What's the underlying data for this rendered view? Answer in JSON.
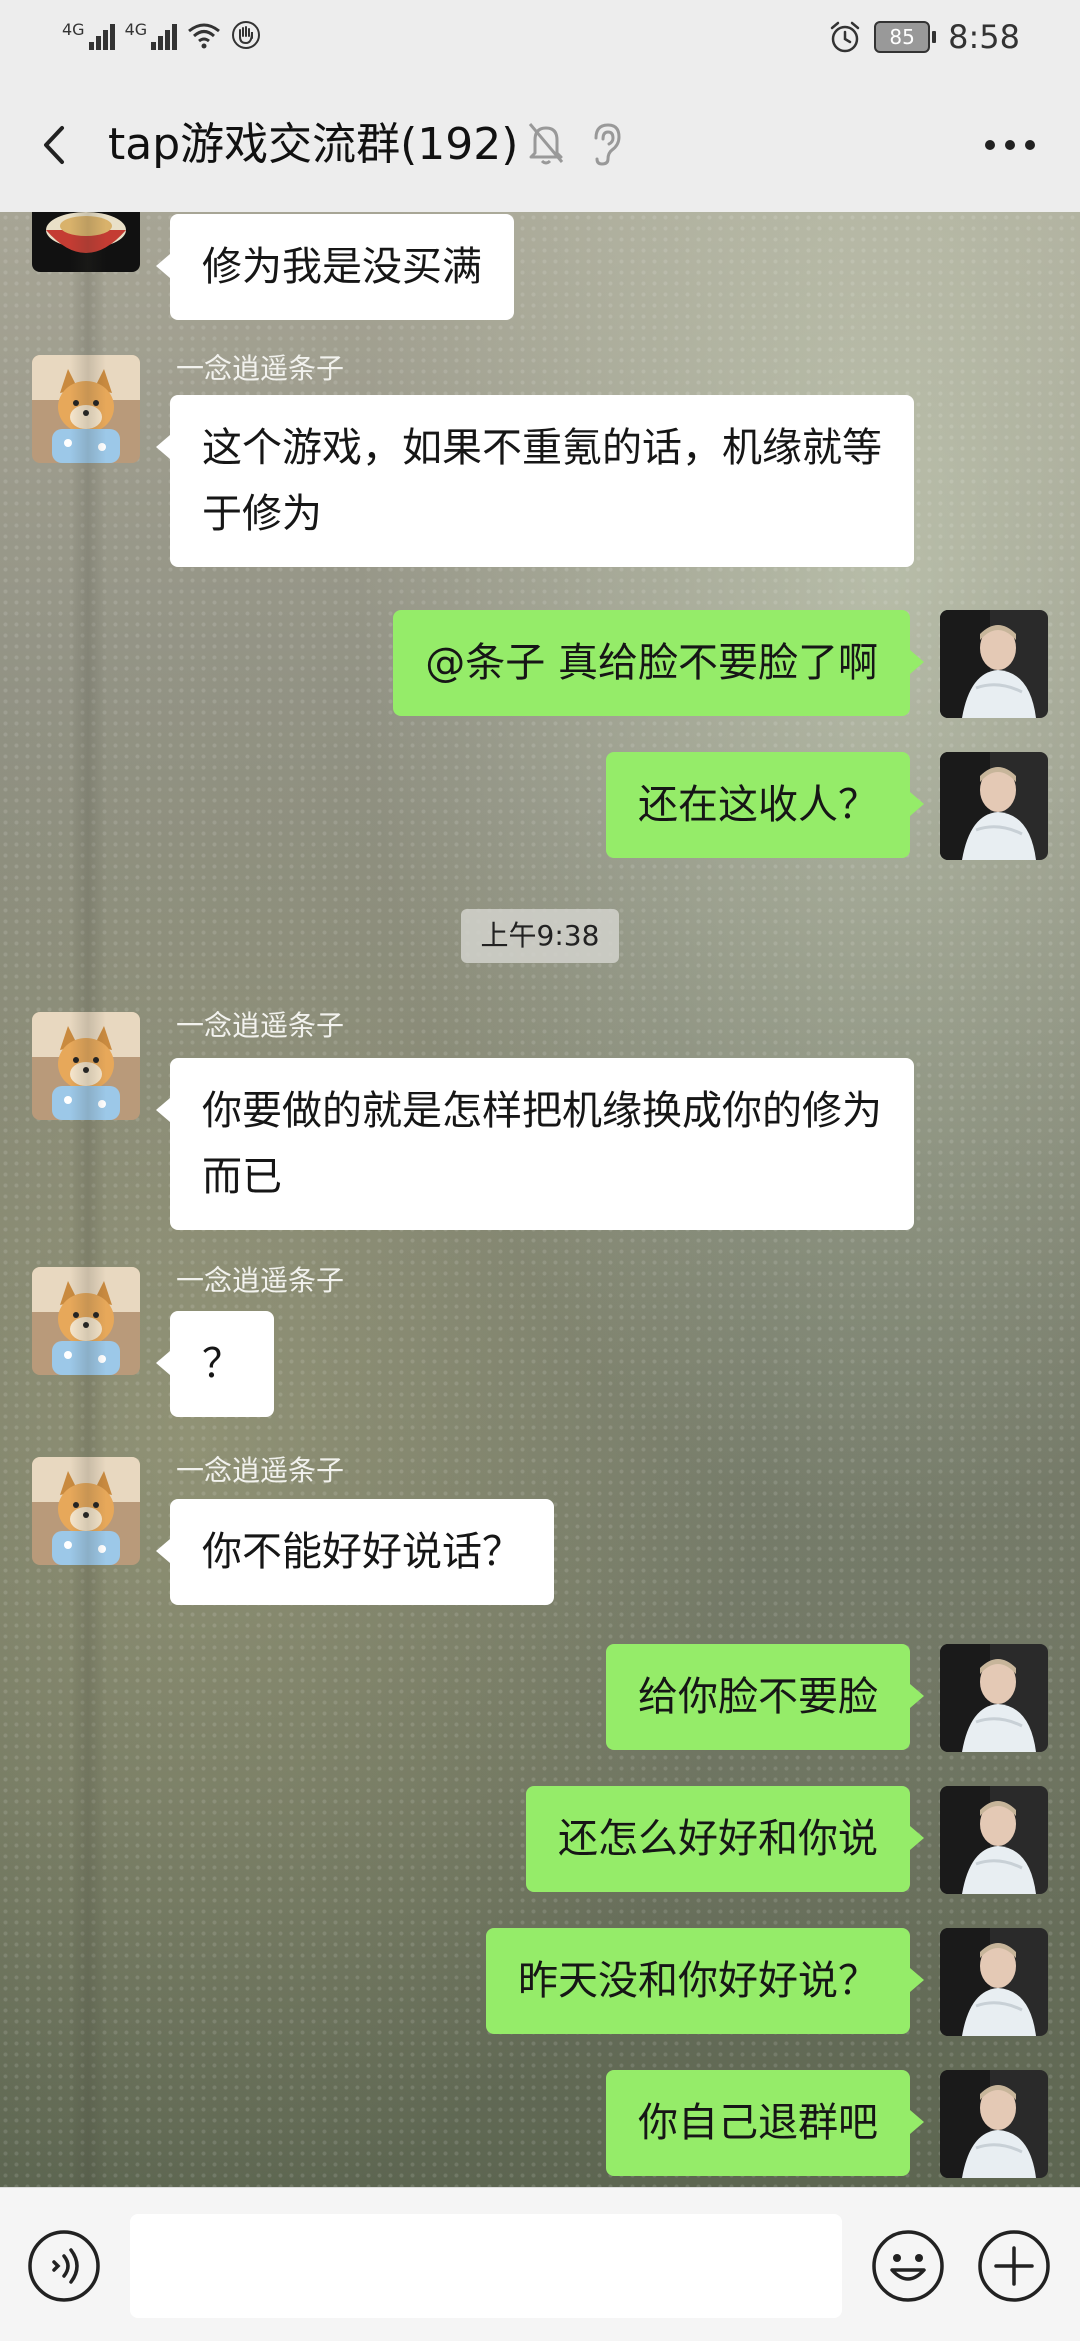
{
  "status_bar": {
    "signal1_label": "4G",
    "signal2_label": "4G",
    "battery_level": "85",
    "time": "8:58",
    "icons": [
      "signal-icon",
      "signal-icon",
      "wifi-icon",
      "hand-icon",
      "alarm-icon",
      "battery-icon"
    ]
  },
  "header": {
    "title": "tap游戏交流群(192)",
    "icons": [
      "back-icon",
      "mute-bell-icon",
      "ear-icon",
      "more-icon"
    ]
  },
  "messages": [
    {
      "side": "left",
      "sender": "",
      "text": "修为我是没买满",
      "avatar": "bowl-avatar"
    },
    {
      "side": "left",
      "sender": "一念逍遥条子",
      "text": "这个游戏，如果不重氪的话，机缘就等于修为",
      "avatar": "dog-avatar"
    },
    {
      "side": "right",
      "sender": "",
      "text": "@条子  真给脸不要脸了啊",
      "avatar": "man-avatar"
    },
    {
      "side": "right",
      "sender": "",
      "text": "还在这收人？",
      "avatar": "man-avatar"
    },
    {
      "side": "left",
      "sender": "一念逍遥条子",
      "text": "你要做的就是怎样把机缘换成你的修为而已",
      "avatar": "dog-avatar"
    },
    {
      "side": "left",
      "sender": "一念逍遥条子",
      "text": "？",
      "avatar": "dog-avatar"
    },
    {
      "side": "left",
      "sender": "一念逍遥条子",
      "text": "你不能好好说话？",
      "avatar": "dog-avatar"
    },
    {
      "side": "right",
      "sender": "",
      "text": "给你脸不要脸",
      "avatar": "man-avatar"
    },
    {
      "side": "right",
      "sender": "",
      "text": "还怎么好好和你说",
      "avatar": "man-avatar"
    },
    {
      "side": "right",
      "sender": "",
      "text": "昨天没和你好好说？",
      "avatar": "man-avatar"
    },
    {
      "side": "right",
      "sender": "",
      "text": "你自己退群吧",
      "avatar": "man-avatar"
    }
  ],
  "timestamp": "上午9:38",
  "input_bar": {
    "placeholder": "",
    "icons": [
      "voice-icon",
      "emoji-icon",
      "plus-icon"
    ]
  },
  "colors": {
    "my_bubble": "#95ec69",
    "other_bubble": "#ffffff",
    "bar_background": "#ededed"
  }
}
